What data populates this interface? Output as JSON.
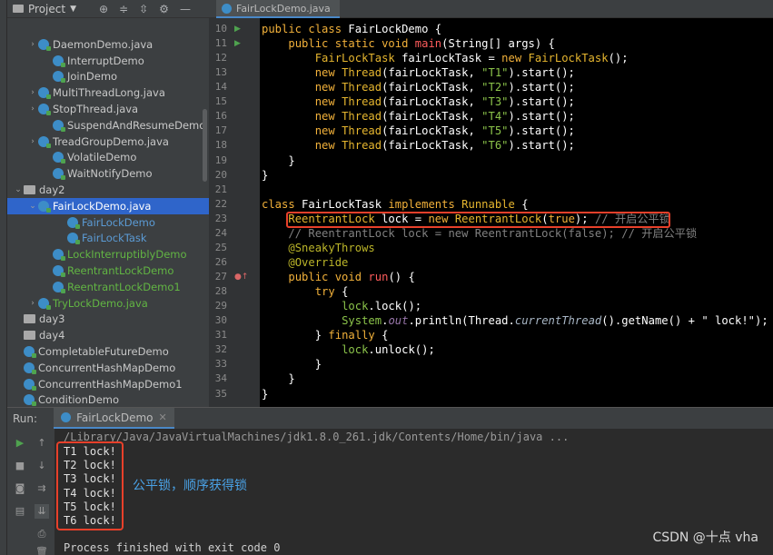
{
  "project": {
    "title": "Project",
    "items": [
      {
        "name": "DaemonDemo.java",
        "indent": 2,
        "chevron": true,
        "icon": "class",
        "color": "default"
      },
      {
        "name": "InterruptDemo",
        "indent": 3,
        "chevron": false,
        "icon": "class",
        "color": "default"
      },
      {
        "name": "JoinDemo",
        "indent": 3,
        "chevron": false,
        "icon": "class",
        "color": "default"
      },
      {
        "name": "MultiThreadLong.java",
        "indent": 2,
        "chevron": true,
        "icon": "class",
        "color": "default"
      },
      {
        "name": "StopThread.java",
        "indent": 2,
        "chevron": true,
        "icon": "class",
        "color": "default"
      },
      {
        "name": "SuspendAndResumeDemo",
        "indent": 3,
        "chevron": false,
        "icon": "class",
        "color": "default"
      },
      {
        "name": "TreadGroupDemo.java",
        "indent": 2,
        "chevron": true,
        "icon": "class",
        "color": "default"
      },
      {
        "name": "VolatileDemo",
        "indent": 3,
        "chevron": false,
        "icon": "class",
        "color": "default"
      },
      {
        "name": "WaitNotifyDemo",
        "indent": 3,
        "chevron": false,
        "icon": "class",
        "color": "default"
      },
      {
        "name": "day2",
        "indent": 1,
        "chevron": "open",
        "icon": "folder",
        "color": "default"
      },
      {
        "name": "FairLockDemo.java",
        "indent": 2,
        "chevron": "open",
        "icon": "class",
        "color": "default",
        "selected": true
      },
      {
        "name": "FairLockDemo",
        "indent": 4,
        "chevron": false,
        "icon": "class",
        "color": "blue"
      },
      {
        "name": "FairLockTask",
        "indent": 4,
        "chevron": false,
        "icon": "class",
        "color": "blue"
      },
      {
        "name": "LockInterruptiblyDemo",
        "indent": 3,
        "chevron": false,
        "icon": "class",
        "color": "green"
      },
      {
        "name": "ReentrantLockDemo",
        "indent": 3,
        "chevron": false,
        "icon": "class",
        "color": "green"
      },
      {
        "name": "ReentrantLockDemo1",
        "indent": 3,
        "chevron": false,
        "icon": "class",
        "color": "green"
      },
      {
        "name": "TryLockDemo.java",
        "indent": 2,
        "chevron": true,
        "icon": "class",
        "color": "green"
      },
      {
        "name": "day3",
        "indent": 1,
        "chevron": false,
        "icon": "folder",
        "color": "default"
      },
      {
        "name": "day4",
        "indent": 1,
        "chevron": false,
        "icon": "folder",
        "color": "default"
      },
      {
        "name": "CompletableFutureDemo",
        "indent": 1,
        "chevron": false,
        "icon": "class",
        "color": "default"
      },
      {
        "name": "ConcurrentHashMapDemo",
        "indent": 1,
        "chevron": false,
        "icon": "class",
        "color": "default"
      },
      {
        "name": "ConcurrentHashMapDemo1",
        "indent": 1,
        "chevron": false,
        "icon": "class",
        "color": "default"
      },
      {
        "name": "ConditionDemo",
        "indent": 1,
        "chevron": false,
        "icon": "class",
        "color": "default"
      }
    ]
  },
  "editor": {
    "tab_label": "FairLockDemo.java",
    "lines": [
      {
        "n": "10",
        "mark": "run",
        "parts": [
          [
            "kw",
            "public class "
          ],
          [
            "wh",
            "FairLockDemo {"
          ]
        ]
      },
      {
        "n": "11",
        "mark": "run",
        "parts": [
          [
            "",
            "    "
          ],
          [
            "kw",
            "public static void "
          ],
          [
            "fn",
            "main"
          ],
          [
            "wh",
            "(String[] args) {"
          ]
        ]
      },
      {
        "n": "12",
        "parts": [
          [
            "",
            "        "
          ],
          [
            "ty",
            "FairLockTask "
          ],
          [
            "wh",
            "fairLockTask = "
          ],
          [
            "kw",
            "new "
          ],
          [
            "ty",
            "FairLockTask"
          ],
          [
            "wh",
            "();"
          ]
        ]
      },
      {
        "n": "13",
        "parts": [
          [
            "",
            "        "
          ],
          [
            "kw",
            "new "
          ],
          [
            "ty",
            "Thread"
          ],
          [
            "wh",
            "(fairLockTask, "
          ],
          [
            "st",
            "\"T1\""
          ],
          [
            "wh",
            ").start();"
          ]
        ]
      },
      {
        "n": "14",
        "parts": [
          [
            "",
            "        "
          ],
          [
            "kw",
            "new "
          ],
          [
            "ty",
            "Thread"
          ],
          [
            "wh",
            "(fairLockTask, "
          ],
          [
            "st",
            "\"T2\""
          ],
          [
            "wh",
            ").start();"
          ]
        ]
      },
      {
        "n": "15",
        "parts": [
          [
            "",
            "        "
          ],
          [
            "kw",
            "new "
          ],
          [
            "ty",
            "Thread"
          ],
          [
            "wh",
            "(fairLockTask, "
          ],
          [
            "st",
            "\"T3\""
          ],
          [
            "wh",
            ").start();"
          ]
        ]
      },
      {
        "n": "16",
        "parts": [
          [
            "",
            "        "
          ],
          [
            "kw",
            "new "
          ],
          [
            "ty",
            "Thread"
          ],
          [
            "wh",
            "(fairLockTask, "
          ],
          [
            "st",
            "\"T4\""
          ],
          [
            "wh",
            ").start();"
          ]
        ]
      },
      {
        "n": "17",
        "parts": [
          [
            "",
            "        "
          ],
          [
            "kw",
            "new "
          ],
          [
            "ty",
            "Thread"
          ],
          [
            "wh",
            "(fairLockTask, "
          ],
          [
            "st",
            "\"T5\""
          ],
          [
            "wh",
            ").start();"
          ]
        ]
      },
      {
        "n": "18",
        "parts": [
          [
            "",
            "        "
          ],
          [
            "kw",
            "new "
          ],
          [
            "ty",
            "Thread"
          ],
          [
            "wh",
            "(fairLockTask, "
          ],
          [
            "st",
            "\"T6\""
          ],
          [
            "wh",
            ").start();"
          ]
        ]
      },
      {
        "n": "19",
        "parts": [
          [
            "",
            "    "
          ],
          [
            "wh",
            "}"
          ]
        ]
      },
      {
        "n": "20",
        "parts": [
          [
            "wh",
            "}"
          ]
        ]
      },
      {
        "n": "21",
        "parts": [
          [
            "",
            ""
          ]
        ]
      },
      {
        "n": "22",
        "parts": [
          [
            "kw",
            "class "
          ],
          [
            "wh",
            "FairLockTask "
          ],
          [
            "kw",
            "implements "
          ],
          [
            "ty",
            "Runnable "
          ],
          [
            "wh",
            "{"
          ]
        ]
      },
      {
        "n": "23",
        "parts": [
          [
            "",
            "    "
          ],
          [
            "ty",
            "ReentrantLock "
          ],
          [
            "wh",
            "lock = "
          ],
          [
            "kw",
            "new "
          ],
          [
            "ty",
            "ReentrantLock"
          ],
          [
            "wh",
            "("
          ],
          [
            "kw",
            "true"
          ],
          [
            "wh",
            ");"
          ],
          [
            "cm",
            " // 开启公平锁"
          ]
        ]
      },
      {
        "n": "24",
        "parts": [
          [
            "",
            "    "
          ],
          [
            "cm",
            "// ReentrantLock lock = new ReentrantLock(false); // 开启公平锁"
          ]
        ]
      },
      {
        "n": "25",
        "parts": [
          [
            "",
            "    "
          ],
          [
            "an",
            "@SneakyThrows"
          ]
        ]
      },
      {
        "n": "26",
        "parts": [
          [
            "",
            "    "
          ],
          [
            "an",
            "@Override"
          ]
        ]
      },
      {
        "n": "27",
        "mark": "impl",
        "parts": [
          [
            "",
            "    "
          ],
          [
            "kw",
            "public void "
          ],
          [
            "fn",
            "run"
          ],
          [
            "wh",
            "() {"
          ]
        ]
      },
      {
        "n": "28",
        "parts": [
          [
            "",
            "        "
          ],
          [
            "kw",
            "try "
          ],
          [
            "wh",
            "{"
          ]
        ]
      },
      {
        "n": "29",
        "parts": [
          [
            "",
            "            "
          ],
          [
            "st",
            "lock"
          ],
          [
            "wh",
            ".lock();"
          ]
        ]
      },
      {
        "n": "30",
        "parts": [
          [
            "",
            "            "
          ],
          [
            "st",
            "System"
          ],
          [
            "wh",
            "."
          ],
          [
            "fld",
            "out"
          ],
          [
            "wh",
            ".println(Thread."
          ],
          [
            "it",
            "currentThread"
          ],
          [
            "wh",
            "().getName() + "
          ],
          [
            "wh",
            "\" lock!\""
          ],
          [
            "wh",
            ");"
          ]
        ]
      },
      {
        "n": "31",
        "parts": [
          [
            "",
            "        "
          ],
          [
            "wh",
            "} "
          ],
          [
            "kw",
            "finally "
          ],
          [
            "wh",
            "{"
          ]
        ]
      },
      {
        "n": "32",
        "parts": [
          [
            "",
            "            "
          ],
          [
            "st",
            "lock"
          ],
          [
            "wh",
            ".unlock();"
          ]
        ]
      },
      {
        "n": "33",
        "parts": [
          [
            "",
            "        "
          ],
          [
            "wh",
            "}"
          ]
        ]
      },
      {
        "n": "34",
        "parts": [
          [
            "",
            "    "
          ],
          [
            "wh",
            "}"
          ]
        ]
      },
      {
        "n": "35",
        "parts": [
          [
            "wh",
            "}"
          ]
        ]
      }
    ]
  },
  "run": {
    "label": "Run:",
    "tab_label": "FairLockDemo",
    "command": "/Library/Java/JavaVirtualMachines/jdk1.8.0_261.jdk/Contents/Home/bin/java ...",
    "output": [
      "T1 lock!",
      "T2 lock!",
      "T3 lock!",
      "T4 lock!",
      "T5 lock!",
      "T6 lock!"
    ],
    "annotation": "公平锁，顺序获得锁",
    "finished": "Process finished with exit code 0"
  },
  "watermark": "CSDN @十点 vha",
  "colors": {
    "accent": "#2f65ca",
    "highlight_box": "#e8402a",
    "annotation": "#4aa3e8"
  }
}
